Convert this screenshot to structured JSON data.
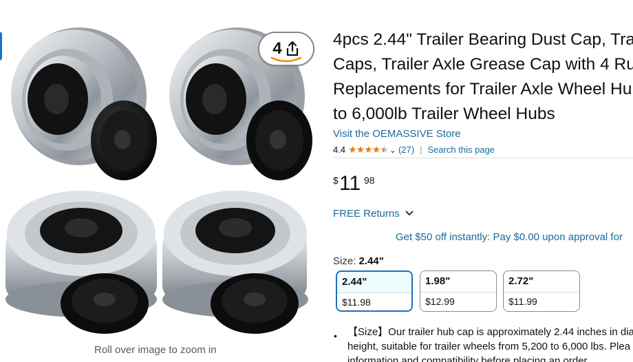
{
  "gallery": {
    "share_count": "4",
    "zoom_hint": "Roll over image to zoom in",
    "images": [
      "product-image-1",
      "product-image-2",
      "product-image-3",
      "product-image-4"
    ]
  },
  "product": {
    "title_lines": [
      "4pcs 2.44\" Trailer Bearing Dust Cap, Trai",
      "Caps, Trailer Axle Grease Cap with 4 Rub",
      "Replacements for Trailer Axle Wheel Hub",
      "to 6,000lb Trailer Wheel Hubs"
    ],
    "store_link": "Visit the OEMASSIVE Store",
    "rating_value": "4.4",
    "rating_stars": 4.4,
    "rating_count": "(27)",
    "search_page": "Search this page",
    "price_symbol": "$",
    "price_whole": "11",
    "price_fraction": "98",
    "free_returns": "FREE Returns",
    "promo": "Get $50 off instantly: Pay $0.00 upon approval for",
    "size_label": "Size:",
    "size_selected": "2.44\"",
    "sizes": [
      {
        "name": "2.44\"",
        "price": "$11.98"
      },
      {
        "name": "1.98\"",
        "price": "$12.99"
      },
      {
        "name": "2.72\"",
        "price": "$11.99"
      }
    ],
    "bullets": [
      "【Size】Our trailer hub cap is approximately 2.44 inches in dia",
      "height, suitable for trailer wheels from 5,200 to 6,000 lbs. Plea",
      "information and compatibility before placing an order."
    ]
  },
  "colors": {
    "link": "#1a6b97",
    "star": "#e67a00",
    "selected_border": "#1f6fbf"
  }
}
